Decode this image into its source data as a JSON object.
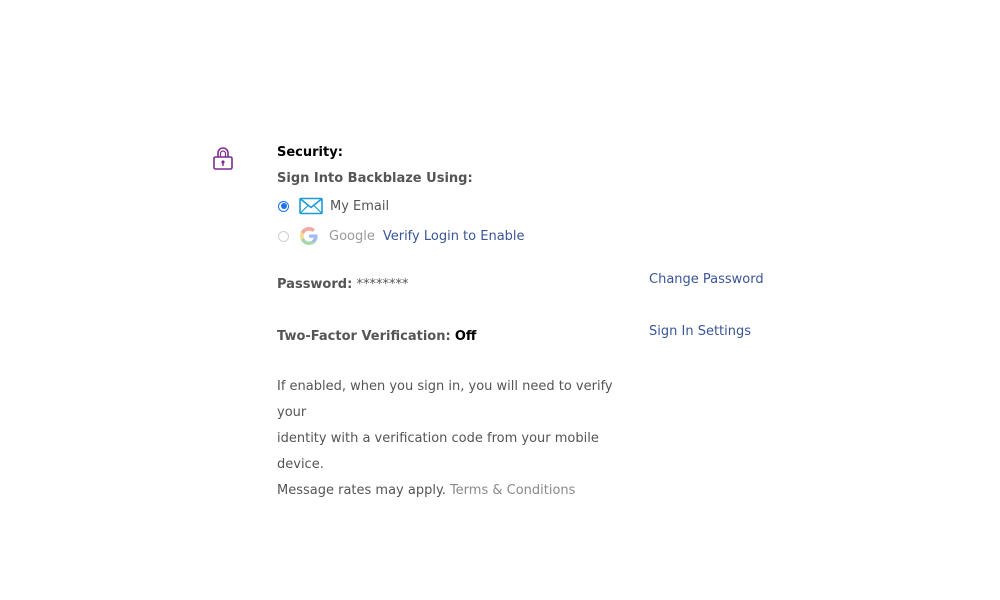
{
  "security": {
    "title": "Security:",
    "subtitle": "Sign Into Backblaze Using:",
    "options": [
      {
        "label": "My Email",
        "selected": true,
        "icon": "mail-icon"
      },
      {
        "label": "Google",
        "selected": false,
        "icon": "google-icon",
        "action": "Verify Login to Enable"
      }
    ],
    "password": {
      "label": "Password:",
      "value": "********",
      "action": "Change Password"
    },
    "two_factor": {
      "label": "Two-Factor Verification:",
      "value": "Off",
      "action": "Sign In Settings"
    },
    "description": {
      "line1": "If enabled, when you sign in, you will need to verify your",
      "line2": "identity with a verification code from your mobile device.",
      "line3": "Message rates may apply.",
      "terms_link": "Terms & Conditions"
    }
  },
  "colors": {
    "link": "#3a5596",
    "radio_selected": "#1a73e8",
    "lock_icon": "#7b2d8e",
    "mail_icon": "#1a9ad6"
  }
}
